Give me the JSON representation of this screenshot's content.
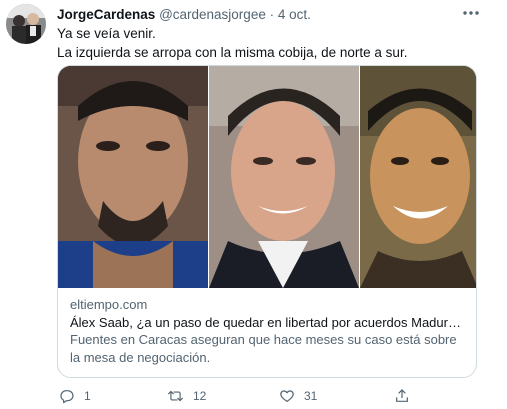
{
  "tweet": {
    "author_name": "JorgeCardenas",
    "author_handle": "@cardenasjorgee",
    "separator": "·",
    "date": "4 oct.",
    "text_line1": "Ya se veía venir.",
    "text_line2": "La izquierda se arropa con la misma cobija, de norte a sur."
  },
  "card": {
    "domain": "eltiempo.com",
    "headline": "Álex Saab, ¿a un paso de quedar en libertad por acuerdos Maduro-Bid...",
    "description": "Fuentes en Caracas aseguran que hace meses su caso está sobre la mesa de negociación."
  },
  "actions": {
    "reply_count": "1",
    "retweet_count": "12",
    "like_count": "31",
    "reply_icon": "reply-icon",
    "retweet_icon": "retweet-icon",
    "like_icon": "heart-icon",
    "share_icon": "share-icon"
  },
  "colors": {
    "text_primary": "#0f1419",
    "text_secondary": "#536471",
    "border": "#cfd9de",
    "background": "#ffffff"
  }
}
